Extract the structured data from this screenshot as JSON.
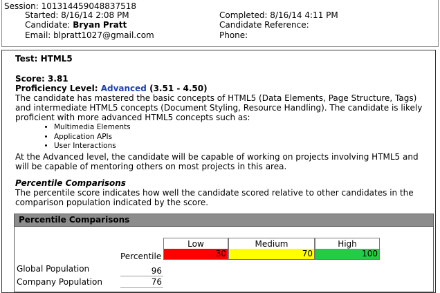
{
  "session": {
    "session_line": "Session: 101314459048837518",
    "started": "Started: 8/16/14 2:08 PM",
    "candidate_label": "Candidate: ",
    "candidate_name": "Bryan Pratt",
    "email": "Email: blpratt1027@gmail.com",
    "completed": "Completed: 8/16/14 4:11 PM",
    "candidate_reference": "Candidate Reference:",
    "phone": "Phone:"
  },
  "test": {
    "title": "Test: HTML5",
    "score": "Score: 3.81",
    "proficiency_label": "Proficiency Level: ",
    "proficiency_level": "Advanced",
    "proficiency_range": "(3.51 - 4.50)",
    "description_lines": [
      "The candidate has mastered the basic concepts of HTML5 (Data Elements, Page Structure, Tags)",
      "and intermediate HTML5 concepts (Document Styling, Resource Handling). The candidate is likely",
      "proficient with more advanced HTML5 concepts such as:"
    ],
    "advanced_topics": [
      "Multimedia Elements",
      "Application APIs",
      "User Interactions"
    ],
    "summary_lines": [
      "At the Advanced level, the candidate will be capable of working on projects involving HTML5 and",
      "will be capable of mentoring others on most projects in this area."
    ]
  },
  "percentile": {
    "heading": "Percentile Comparisons",
    "description_lines": [
      "The percentile score indicates how well the candidate scored relative to other candidates in the",
      "comparison population indicated by the score."
    ],
    "table_header": "Percentile Comparisons",
    "percentile_label": "Percentile",
    "bands": [
      {
        "label": "Low",
        "max": "30",
        "color": "#ff0000"
      },
      {
        "label": "Medium",
        "max": "70",
        "color": "#ffff00"
      },
      {
        "label": "High",
        "max": "100",
        "color": "#22cc44"
      }
    ],
    "rows": [
      {
        "label": "Global Population",
        "value": "96"
      },
      {
        "label": "Company Population",
        "value": "76"
      }
    ]
  }
}
